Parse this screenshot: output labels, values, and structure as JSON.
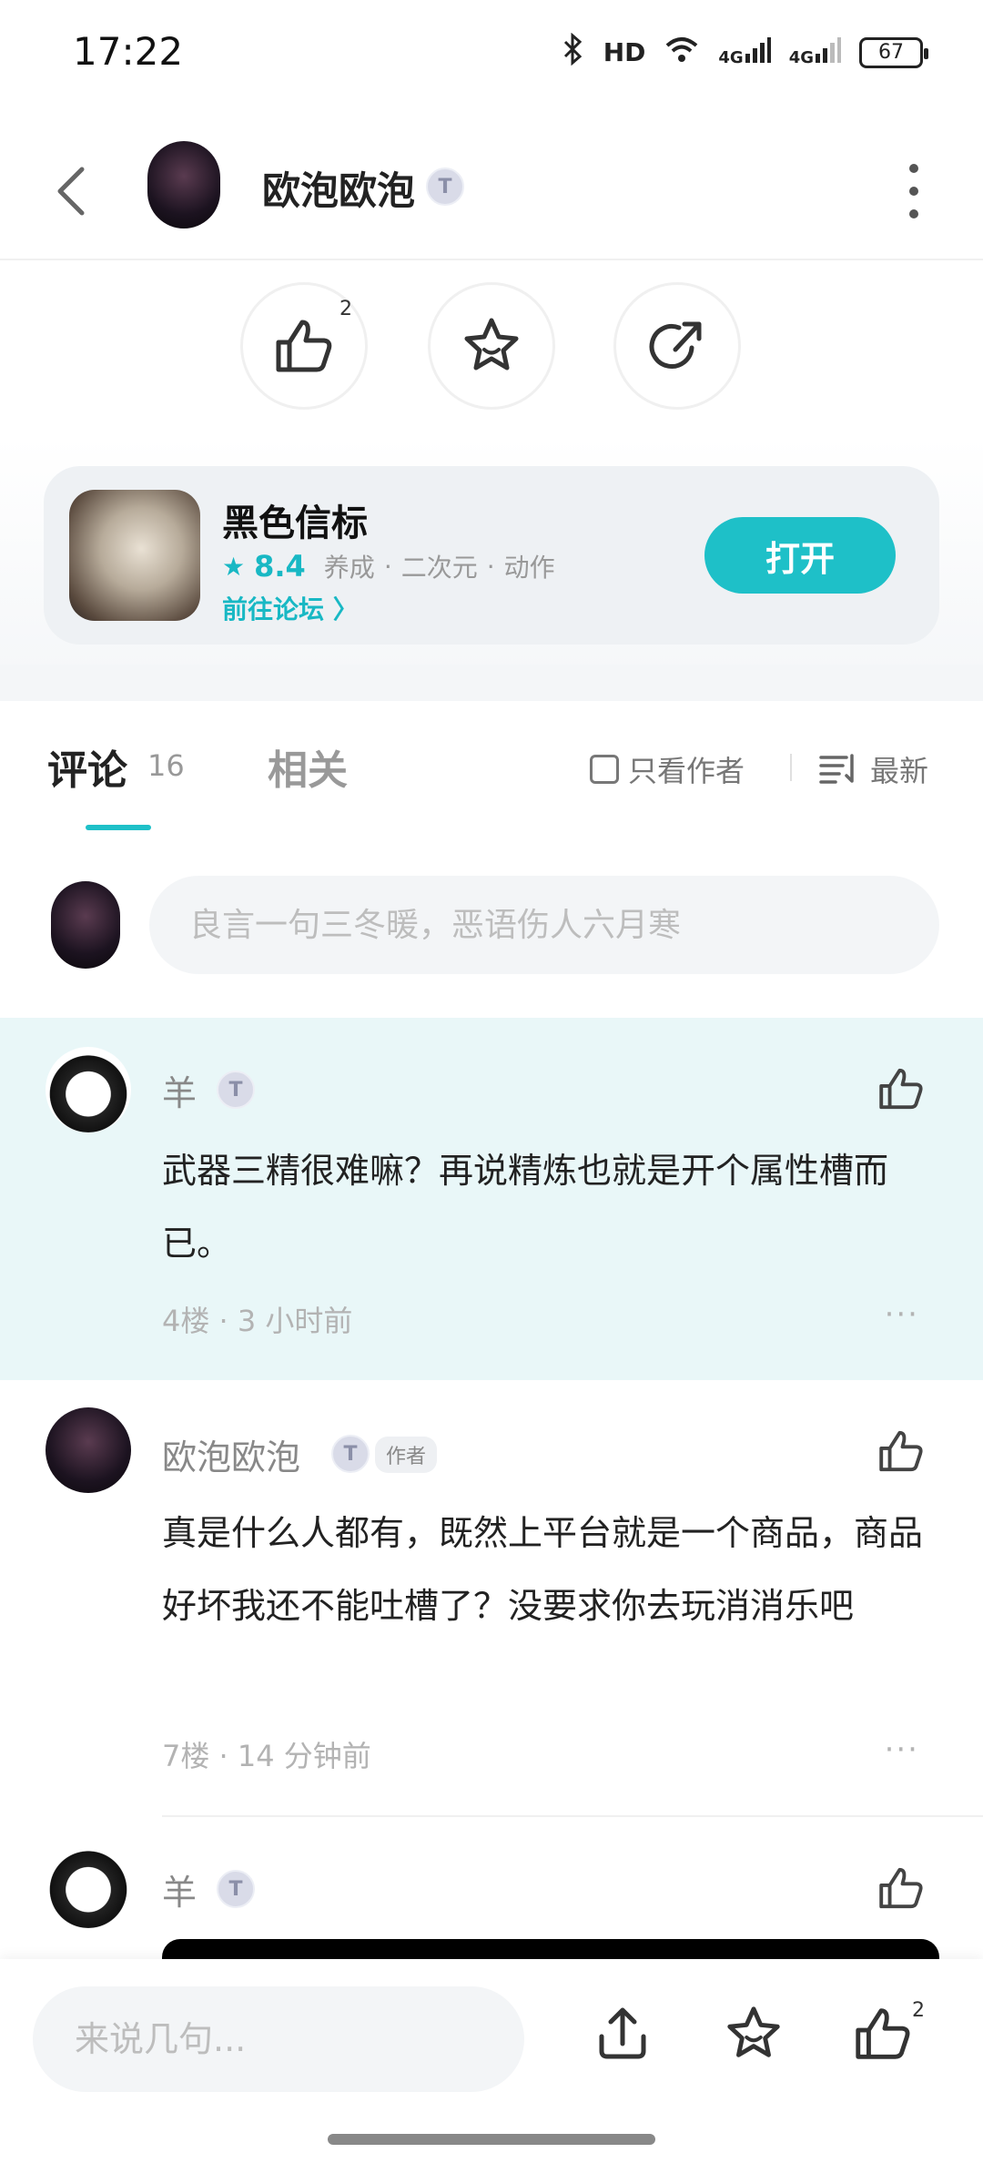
{
  "status_bar": {
    "time": "17:22",
    "network_1": "HD",
    "network_2": "4G",
    "network_3": "4G",
    "battery": "67"
  },
  "header": {
    "user_name": "欧泡欧泡",
    "badge": "T",
    "icons": [
      "back-arrow-icon",
      "more-vertical-icon"
    ]
  },
  "actions": {
    "like_count": "2",
    "icons": [
      "thumbs-up-icon",
      "star-icon",
      "share-icon"
    ]
  },
  "game_card": {
    "name": "黑色信标",
    "score": "8.4",
    "tags": [
      "养成",
      "二次元",
      "动作"
    ],
    "tag_separator": "·",
    "forum_link": "前往论坛 〉",
    "open_button": "打开",
    "accent_color": "#1ec0c8"
  },
  "tabs": {
    "comment_label": "评论",
    "comment_count": "16",
    "related_label": "相关",
    "author_only": "只看作者",
    "sort_label": "最新"
  },
  "comment_input": {
    "placeholder": "良言一句三冬暖，恶语伤人六月寒"
  },
  "comments": [
    {
      "name": "羊",
      "badge": "T",
      "text": "武器三精很难嘛？再说精炼也就是开个属性槽而已。",
      "meta": "4楼 · 3 小时前",
      "more": "···"
    },
    {
      "name": "欧泡欧泡",
      "badge": "T",
      "author_tag": "作者",
      "text": "真是什么人都有，既然上平台就是一个商品，商品好坏我还不能吐槽了？没要求你去玩消消乐吧",
      "meta": "7楼 · 14 分钟前",
      "more": "···"
    },
    {
      "name": "羊",
      "badge": "T"
    }
  ],
  "bottom_bar": {
    "placeholder": "来说几句...",
    "like_count": "2",
    "icons": [
      "upload-share-icon",
      "star-icon",
      "thumbs-up-icon"
    ]
  }
}
